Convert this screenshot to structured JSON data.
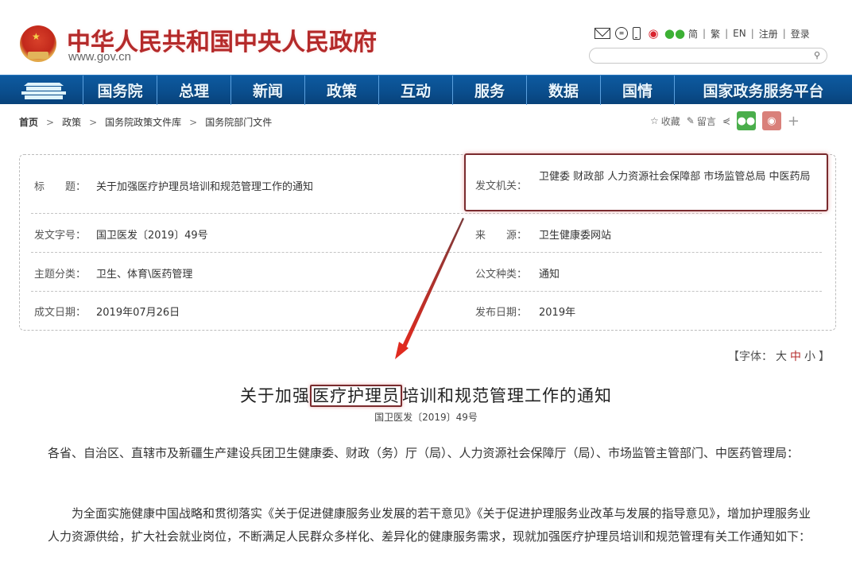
{
  "header": {
    "site_title": "中华人民共和国中央人民政府",
    "site_url": "www.gov.cn",
    "top_icons": [
      "mail-icon",
      "chat-icon",
      "mobile-icon",
      "weibo-icon",
      "wechat-icon"
    ],
    "lang_links": [
      "简",
      "繁",
      "EN",
      "注册",
      "登录"
    ],
    "search": {
      "placeholder": "",
      "value": ""
    }
  },
  "nav": {
    "items": [
      "国务院",
      "总理",
      "新闻",
      "政策",
      "互动",
      "服务",
      "数据",
      "国情",
      "国家政务服务平台"
    ]
  },
  "breadcrumb": {
    "items": [
      "首页",
      "政策",
      "国务院政策文件库",
      "国务院部门文件"
    ],
    "separator": ">"
  },
  "share_bar": {
    "favorite_label": "收藏",
    "comment_label": "留言",
    "more_label": "+"
  },
  "info": {
    "rows": [
      {
        "left_label": "标　　题：",
        "left_value": "关于加强医疗护理员培训和规范管理工作的通知",
        "right_label": "发文机关：",
        "right_value": "卫健委 财政部 人力资源社会保障部 市场监管总局 中医药局"
      },
      {
        "left_label": "发文字号：",
        "left_value": "国卫医发〔2019〕49号",
        "right_label": "来　　源：",
        "right_value": "卫生健康委网站"
      },
      {
        "left_label": "主题分类：",
        "left_value": "卫生、体育\\医药管理",
        "right_label": "公文种类：",
        "right_value": "通知"
      },
      {
        "left_label": "成文日期：",
        "left_value": "2019年07月26日",
        "right_label": "发布日期：",
        "right_value": "2019年"
      }
    ]
  },
  "font_size": {
    "prefix": "【字体：",
    "options": [
      "大",
      "中",
      "小"
    ],
    "suffix": "】"
  },
  "document": {
    "title_before": "关于加强",
    "title_highlight": "医疗护理员",
    "title_after": "培训和规范管理工作的通知",
    "doc_number": "国卫医发〔2019〕49号",
    "paragraphs": [
      "各省、自治区、直辖市及新疆生产建设兵团卫生健康委、财政（务）厅（局）、人力资源社会保障厅（局）、市场监管主管部门、中医药管理局：",
      "为全面实施健康中国战略和贯彻落实《关于促进健康服务业发展的若干意见》《关于促进护理服务业改革与发展的指导意见》，增加护理服务业人力资源供给，扩大社会就业岗位，不断满足人民群众多样化、差异化的健康服务需求，现就加强医疗护理员培训和规范管理有关工作通知如下："
    ]
  },
  "colors": {
    "brand_red": "#b42a2a",
    "nav_blue": "#0a4d8c",
    "annotation": "#7a2b2e",
    "arrow": "#d2342a"
  }
}
